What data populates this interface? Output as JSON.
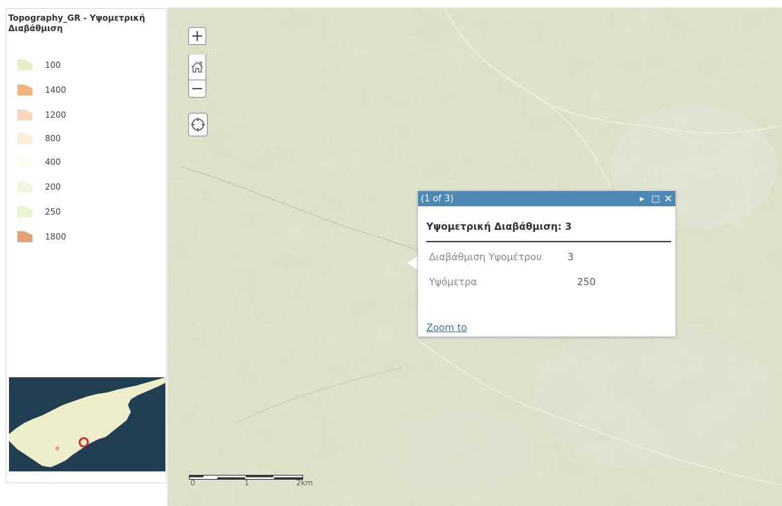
{
  "legend": {
    "title": "Topography_GR - Υψομετρική Διαβάθμιση",
    "items": [
      {
        "label": "100",
        "color": "#e4f0c7"
      },
      {
        "label": "1400",
        "color": "#f0b47f"
      },
      {
        "label": "1200",
        "color": "#fbd8b8"
      },
      {
        "label": "800",
        "color": "#fbf0dc"
      },
      {
        "label": "400",
        "color": "#fbfbef"
      },
      {
        "label": "200",
        "color": "#f1f5df"
      },
      {
        "label": "250",
        "color": "#e8f5d3"
      },
      {
        "label": "1800",
        "color": "#e6a279"
      }
    ]
  },
  "map_controls": {
    "zoom_in": "+",
    "zoom_out": "−",
    "home_icon": "home-icon",
    "locate_icon": "locate-icon"
  },
  "popup": {
    "counter": "(1 of 3)",
    "title": "Υψομετρική Διαβάθμιση: 3",
    "attributes": [
      {
        "label": "Διαβάθμιση Υψομέτρου",
        "value": "3"
      },
      {
        "label": "Υψόμετρα",
        "value": "250"
      }
    ],
    "zoom_link": "Zoom to",
    "header_color": "#4e88b5"
  },
  "scalebar": {
    "labels": [
      "0",
      "1",
      "2km"
    ]
  },
  "colors": {
    "overview_sea": "#213e52",
    "overview_land": "#eeeecb",
    "map_base": "#d7dcc0"
  }
}
